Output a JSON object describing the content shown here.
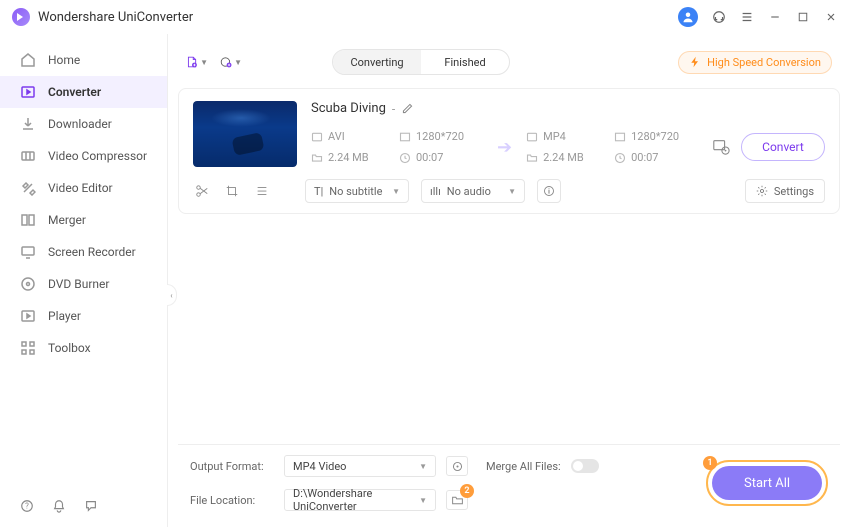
{
  "app": {
    "title": "Wondershare UniConverter"
  },
  "titlebar_icons": {
    "headset": "headset-icon",
    "menu": "menu-icon",
    "minimize": "minimize-icon",
    "maximize": "maximize-icon",
    "close": "close-icon"
  },
  "sidebar": {
    "items": [
      {
        "label": "Home",
        "icon": "home-icon",
        "active": false
      },
      {
        "label": "Converter",
        "icon": "converter-icon",
        "active": true
      },
      {
        "label": "Downloader",
        "icon": "downloader-icon",
        "active": false
      },
      {
        "label": "Video Compressor",
        "icon": "compressor-icon",
        "active": false
      },
      {
        "label": "Video Editor",
        "icon": "editor-icon",
        "active": false
      },
      {
        "label": "Merger",
        "icon": "merger-icon",
        "active": false
      },
      {
        "label": "Screen Recorder",
        "icon": "screen-recorder-icon",
        "active": false
      },
      {
        "label": "DVD Burner",
        "icon": "dvd-burner-icon",
        "active": false
      },
      {
        "label": "Player",
        "icon": "player-icon",
        "active": false
      },
      {
        "label": "Toolbox",
        "icon": "toolbox-icon",
        "active": false
      }
    ]
  },
  "tabs": {
    "converting": "Converting",
    "finished": "Finished",
    "active": "Converting"
  },
  "hsc": "High Speed Conversion",
  "item": {
    "name": "Scuba Diving",
    "src": {
      "format": "AVI",
      "res": "1280*720",
      "size": "2.24 MB",
      "dur": "00:07"
    },
    "dst": {
      "format": "MP4",
      "res": "1280*720",
      "size": "2.24 MB",
      "dur": "00:07"
    },
    "convert_btn": "Convert",
    "subtitle": "No subtitle",
    "audio": "No audio",
    "settings": "Settings"
  },
  "bottom": {
    "output_format_label": "Output Format:",
    "output_format_value": "MP4 Video",
    "file_location_label": "File Location:",
    "file_location_value": "D:\\Wondershare UniConverter",
    "merge_label": "Merge All Files:",
    "startall": "Start All",
    "callouts": {
      "one": "1",
      "two": "2"
    }
  }
}
